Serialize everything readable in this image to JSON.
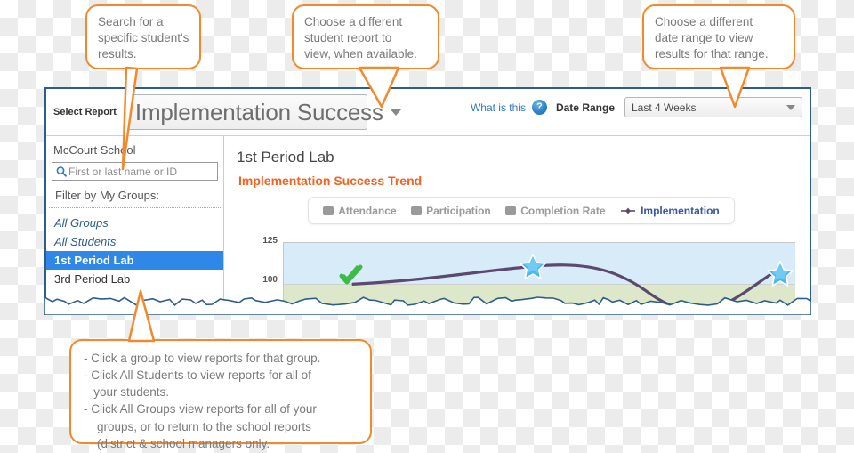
{
  "callouts": {
    "search": {
      "name": "search-callout",
      "lines": [
        "Search for a",
        "specific student's",
        "results."
      ]
    },
    "report": {
      "name": "report-callout",
      "lines": [
        "Choose a different",
        "student report to",
        "view, when available."
      ]
    },
    "date": {
      "name": "date-callout",
      "lines": [
        "Choose a different",
        "date range to view",
        "results for that range."
      ]
    },
    "groups": {
      "name": "groups-callout",
      "lines": [
        "- Click a group to view reports for that group.",
        "- Click All Students to view reports for all of",
        "   your students.",
        "- Click All Groups view reports for all of your",
        "    groups, or to return to the school reports",
        "    (district & school managers only."
      ]
    }
  },
  "header": {
    "select_report_label": "Select Report",
    "report_value": "Implementation Success",
    "what_is_this": "What is this",
    "help_icon_glyph": "?",
    "help_icon_name": "question-mark-icon",
    "date_range_label": "Date Range",
    "date_range_value": "Last 4 Weeks"
  },
  "sidebar": {
    "school": "McCourt School",
    "search_placeholder": "First or last name or ID",
    "search_value": "",
    "search_icon_name": "magnifier-icon",
    "filter_label": "Filter by My Groups:",
    "groups": [
      {
        "label": "All Groups",
        "style": "italic",
        "selected": false
      },
      {
        "label": "All Students",
        "style": "italic",
        "selected": false
      },
      {
        "label": "1st Period Lab",
        "style": "plain",
        "selected": true
      },
      {
        "label": "3rd Period Lab",
        "style": "plain",
        "selected": false
      }
    ]
  },
  "main": {
    "report_title": "1st Period Lab",
    "trend_title": "Implementation Success Trend",
    "legend": [
      {
        "label": "Attendance",
        "marker": "square",
        "active": false
      },
      {
        "label": "Participation",
        "marker": "square",
        "active": false
      },
      {
        "label": "Completion Rate",
        "marker": "square",
        "active": false
      },
      {
        "label": "Implementation",
        "marker": "line-diamond",
        "active": true
      }
    ]
  },
  "chart_data": {
    "type": "line",
    "title": "Implementation Success Trend",
    "xlabel": "",
    "ylabel": "",
    "ylim": [
      85,
      125
    ],
    "yticks": [
      100,
      125
    ],
    "ytick_labels": [
      "100",
      "125"
    ],
    "grid": false,
    "bands": [
      {
        "from": 100,
        "to": 125,
        "color": "#d8ebf8"
      },
      {
        "from": 85,
        "to": 100,
        "color": "#dde8cb"
      }
    ],
    "series": [
      {
        "name": "Implementation",
        "color": "#5b4a6e",
        "x": [
          0,
          1,
          2,
          3,
          4,
          5
        ],
        "values": [
          96,
          99.5,
          104,
          96,
          90.5,
          101
        ],
        "markers": [
          {
            "x": 0,
            "y": 96,
            "type": "check",
            "color": "#3dbb4a"
          },
          {
            "x": 2,
            "y": 104,
            "type": "star",
            "color": "#3fb4ef"
          },
          {
            "x": 5,
            "y": 101,
            "type": "star",
            "color": "#3fb4ef"
          }
        ]
      }
    ]
  },
  "colors": {
    "accent_orange": "#f08a2c",
    "trend_title_orange": "#f4621f",
    "window_border_blue": "#2c5d8f",
    "selection_blue": "#2f87e8",
    "link_blue": "#2f78c4",
    "legend_active_blue": "#3857a8",
    "series_purple": "#5b4a6e",
    "band_blue": "#d8ebf8",
    "band_green": "#dde8cb"
  }
}
